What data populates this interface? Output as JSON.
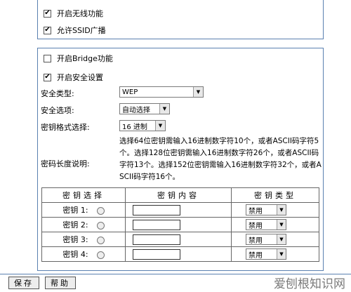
{
  "wireless": {
    "enable_wireless": {
      "label": "开启无线功能",
      "checked": true
    },
    "allow_ssid_broadcast": {
      "label": "允许SSID广播",
      "checked": true
    }
  },
  "bridge": {
    "label": "开启Bridge功能",
    "checked": false
  },
  "security": {
    "enable_security": {
      "label": "开启安全设置",
      "checked": true
    },
    "type_label": "安全类型:",
    "type_value": "WEP",
    "option_label": "安全选项:",
    "option_value": "自动选择",
    "key_format_label": "密钥格式选择:",
    "key_format_value": "16 进制",
    "key_length_label": "密码长度说明:",
    "key_length_text": "选择64位密钥需输入16进制数字符10个，或者ASCII码字符5个。选择128位密钥需输入16进制数字符26个，或者ASCII码字符13个。选择152位密钥需输入16进制数字符32个，或者ASCII码字符16个。"
  },
  "key_table": {
    "headers": [
      "密钥选择",
      "密钥内容",
      "密钥类型"
    ],
    "rows": [
      {
        "label": "密钥 1:",
        "value": "",
        "type": "禁用"
      },
      {
        "label": "密钥 2:",
        "value": "",
        "type": "禁用"
      },
      {
        "label": "密钥 3:",
        "value": "",
        "type": "禁用"
      },
      {
        "label": "密钥 4:",
        "value": "",
        "type": "禁用"
      }
    ]
  },
  "buttons": {
    "save": "保存",
    "help": "帮助"
  },
  "watermark": "爱刨根知识网"
}
